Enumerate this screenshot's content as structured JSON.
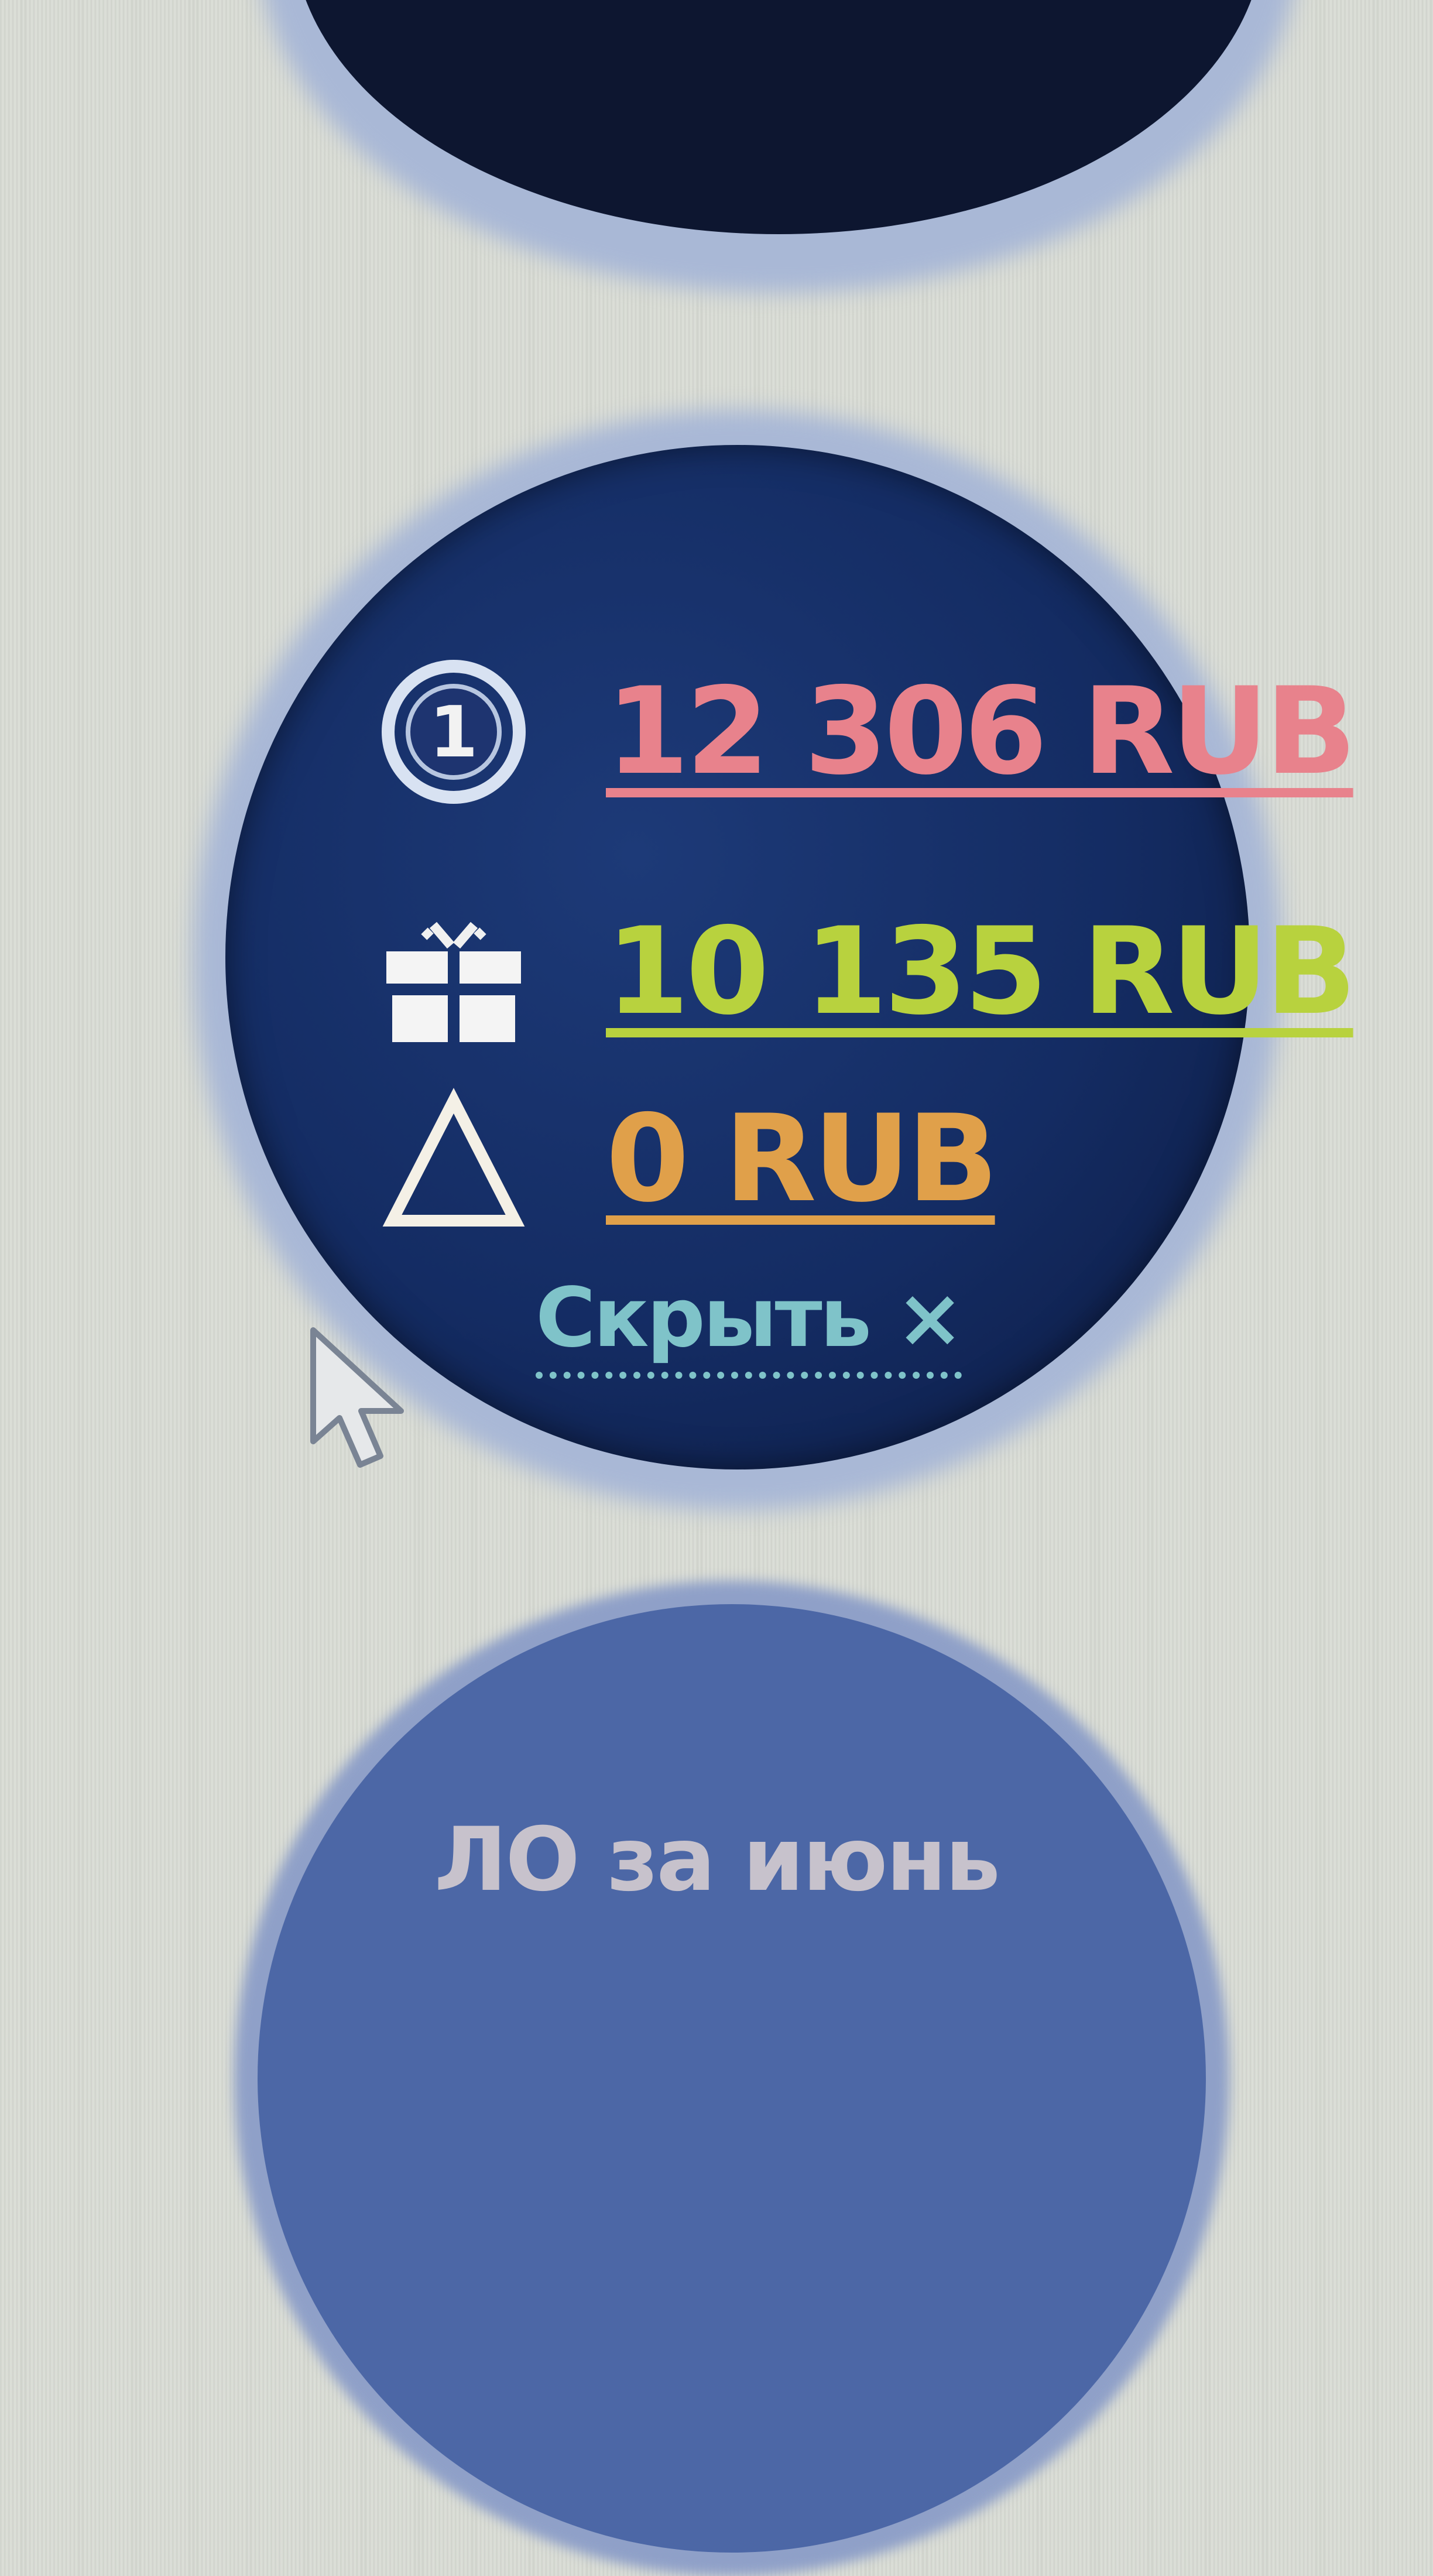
{
  "balances": [
    {
      "icon": "coin-one-icon",
      "amount": "12 306 RUB",
      "color": "#e8828c"
    },
    {
      "icon": "gift-icon",
      "amount": "10 135 RUB",
      "color": "#b8d23e"
    },
    {
      "icon": "triangle-icon",
      "amount": "0 RUB",
      "color": "#e0a04a"
    }
  ],
  "hide_link": {
    "label": "Скрыть ×",
    "color": "#7fc3c9"
  },
  "next_button": {
    "label": "ЛО за июнь"
  }
}
